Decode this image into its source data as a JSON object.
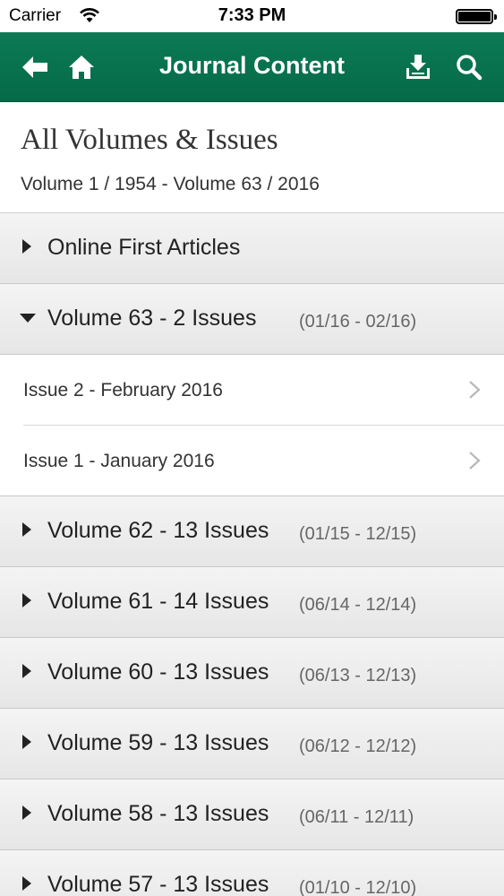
{
  "status_bar": {
    "carrier": "Carrier",
    "time": "7:33 PM",
    "icons": [
      "wifi-icon",
      "battery-icon"
    ]
  },
  "nav": {
    "title": "Journal Content",
    "background_color": "#097251",
    "icons": [
      "back-arrow-icon",
      "home-icon",
      "download-icon",
      "search-icon"
    ]
  },
  "header": {
    "title": "All Volumes & Issues",
    "subtitle": "Volume 1 / 1954 - Volume 63 / 2016"
  },
  "list": {
    "online_first": {
      "label": "Online First Articles",
      "expanded": false
    },
    "volumes": [
      {
        "label": "Volume 63 - 2 Issues",
        "range": "(01/16 - 02/16)",
        "expanded": true,
        "issues": [
          {
            "label": "Issue 2 - February 2016"
          },
          {
            "label": "Issue 1 - January 2016"
          }
        ]
      },
      {
        "label": "Volume 62 - 13 Issues",
        "range": "(01/15 - 12/15)",
        "expanded": false
      },
      {
        "label": "Volume 61 - 14 Issues",
        "range": "(06/14 - 12/14)",
        "expanded": false
      },
      {
        "label": "Volume 60 - 13 Issues",
        "range": "(06/13 - 12/13)",
        "expanded": false
      },
      {
        "label": "Volume 59 - 13 Issues",
        "range": "(06/12 - 12/12)",
        "expanded": false
      },
      {
        "label": "Volume 58 - 13 Issues",
        "range": "(06/11 - 12/11)",
        "expanded": false
      },
      {
        "label": "Volume 57 - 13 Issues",
        "range": "(01/10 - 12/10)",
        "expanded": false
      }
    ]
  }
}
